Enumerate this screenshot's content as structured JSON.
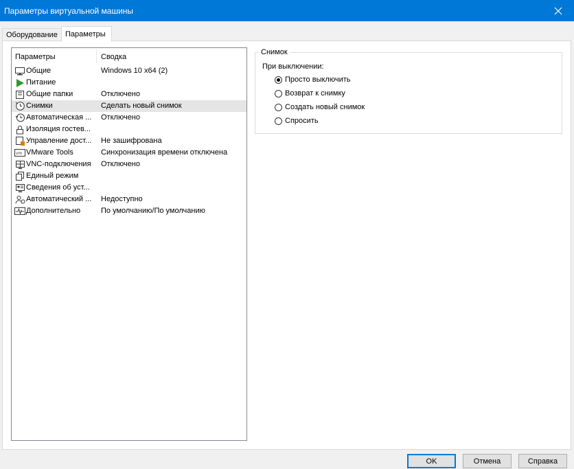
{
  "window": {
    "title": "Параметры виртуальной машины"
  },
  "tabs": [
    {
      "label": "Оборудование",
      "active": false
    },
    {
      "label": "Параметры",
      "active": true
    }
  ],
  "list": {
    "columns": [
      "Параметры",
      "Сводка"
    ],
    "rows": [
      {
        "icon": "monitor-icon",
        "name": "Общие",
        "summary": "Windows 10 x64 (2)"
      },
      {
        "icon": "power-play-icon",
        "name": "Питание",
        "summary": ""
      },
      {
        "icon": "shared-folder-icon",
        "name": "Общие папки",
        "summary": "Отключено"
      },
      {
        "icon": "snapshot-clock-icon",
        "name": "Снимки",
        "summary": "Сделать новый снимок",
        "selected": true
      },
      {
        "icon": "autosave-clock-icon",
        "name": "Автоматическая ...",
        "summary": "Отключено"
      },
      {
        "icon": "lock-icon",
        "name": "Изоляция гостев...",
        "summary": ""
      },
      {
        "icon": "access-control-icon",
        "name": "Управление дост...",
        "summary": "Не зашифрована"
      },
      {
        "icon": "vmware-tools-icon",
        "name": "VMware Tools",
        "summary": "Синхронизация времени отключена"
      },
      {
        "icon": "vnc-icon",
        "name": "VNC-подключения",
        "summary": "Отключено"
      },
      {
        "icon": "unity-icon",
        "name": "Единый режим",
        "summary": ""
      },
      {
        "icon": "device-info-icon",
        "name": "Сведения об уст...",
        "summary": ""
      },
      {
        "icon": "autologon-users-icon",
        "name": "Автоматический ...",
        "summary": "Недоступно"
      },
      {
        "icon": "advanced-waveform-icon",
        "name": "Дополнительно",
        "summary": "По умолчанию/По умолчанию"
      }
    ]
  },
  "snapshot_group": {
    "legend": "Снимок",
    "label": "При выключении:",
    "options": [
      {
        "label": "Просто выключить",
        "checked": true
      },
      {
        "label": "Возврат к снимку",
        "checked": false
      },
      {
        "label": "Создать новый снимок",
        "checked": false
      },
      {
        "label": "Спросить",
        "checked": false
      }
    ]
  },
  "buttons": {
    "ok": "OK",
    "cancel": "Отмена",
    "help": "Справка"
  },
  "colors": {
    "titlebar": "#0078d7",
    "default_button_border": "#0078d7",
    "power_green": "#2e9a2e",
    "lock_orange": "#e07b00"
  }
}
